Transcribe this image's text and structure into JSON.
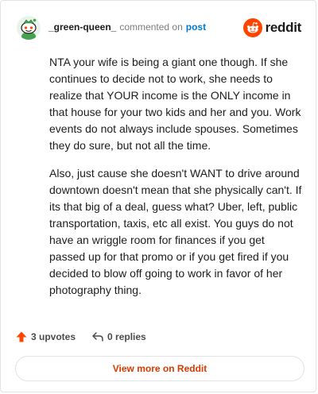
{
  "comment": {
    "username": "_green-queen_",
    "action_text": "commented on",
    "post_link": "post",
    "paragraphs": [
      "NTA your wife is being a giant one though. If she continues to decide not to work, she needs to realize that YOUR income is the ONLY income in that house for your two kids and her and you. Work events do not always include spouses. Sometimes they do sure, but not all the time.",
      "Also, just cause she doesn't WANT to drive around downtown doesn't mean that she physically can't. If its that big of a deal, guess what? Uber, left, public transportation, taxis, etc all exist. You guys do not have an wriggle room for finances if you get passed up for that promo or if you get fired if you decided to blow off going to work in favor of her photography thing."
    ],
    "upvotes_label": "3 upvotes",
    "replies_label": "0 replies",
    "view_more_label": "View more on Reddit"
  },
  "brand": {
    "name": "reddit",
    "icon": "reddit-logo-icon",
    "accent_color": "#ff4500"
  },
  "icons": {
    "avatar": "snoo-avatar",
    "upvote": "upvote-arrow-icon",
    "reply": "reply-arrow-icon"
  },
  "colors": {
    "upvote": "#ff4500",
    "link": "#0079d3",
    "view_more_text": "#d93a00"
  }
}
